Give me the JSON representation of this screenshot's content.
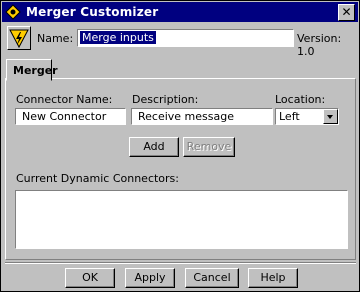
{
  "window": {
    "title": "Merger  Customizer",
    "close_label": "✕"
  },
  "header": {
    "name_label": "Name:",
    "name_value": "Merge inputs",
    "version_label": "Version: 1.0"
  },
  "tabs": [
    {
      "label": "Merger"
    }
  ],
  "form": {
    "connector_name_label": "Connector Name:",
    "connector_name_value": "New Connector",
    "description_label": "Description:",
    "description_value": "Receive message",
    "location_label": "Location:",
    "location_value": "Left",
    "add_label": "Add",
    "remove_label": "Remove",
    "current_label": "Current Dynamic Connectors:"
  },
  "footer": {
    "ok_label": "OK",
    "apply_label": "Apply",
    "cancel_label": "Cancel",
    "help_label": "Help"
  },
  "icons": {
    "title_icon": "component-icon",
    "logo_icon": "lightning-bolt-icon"
  }
}
